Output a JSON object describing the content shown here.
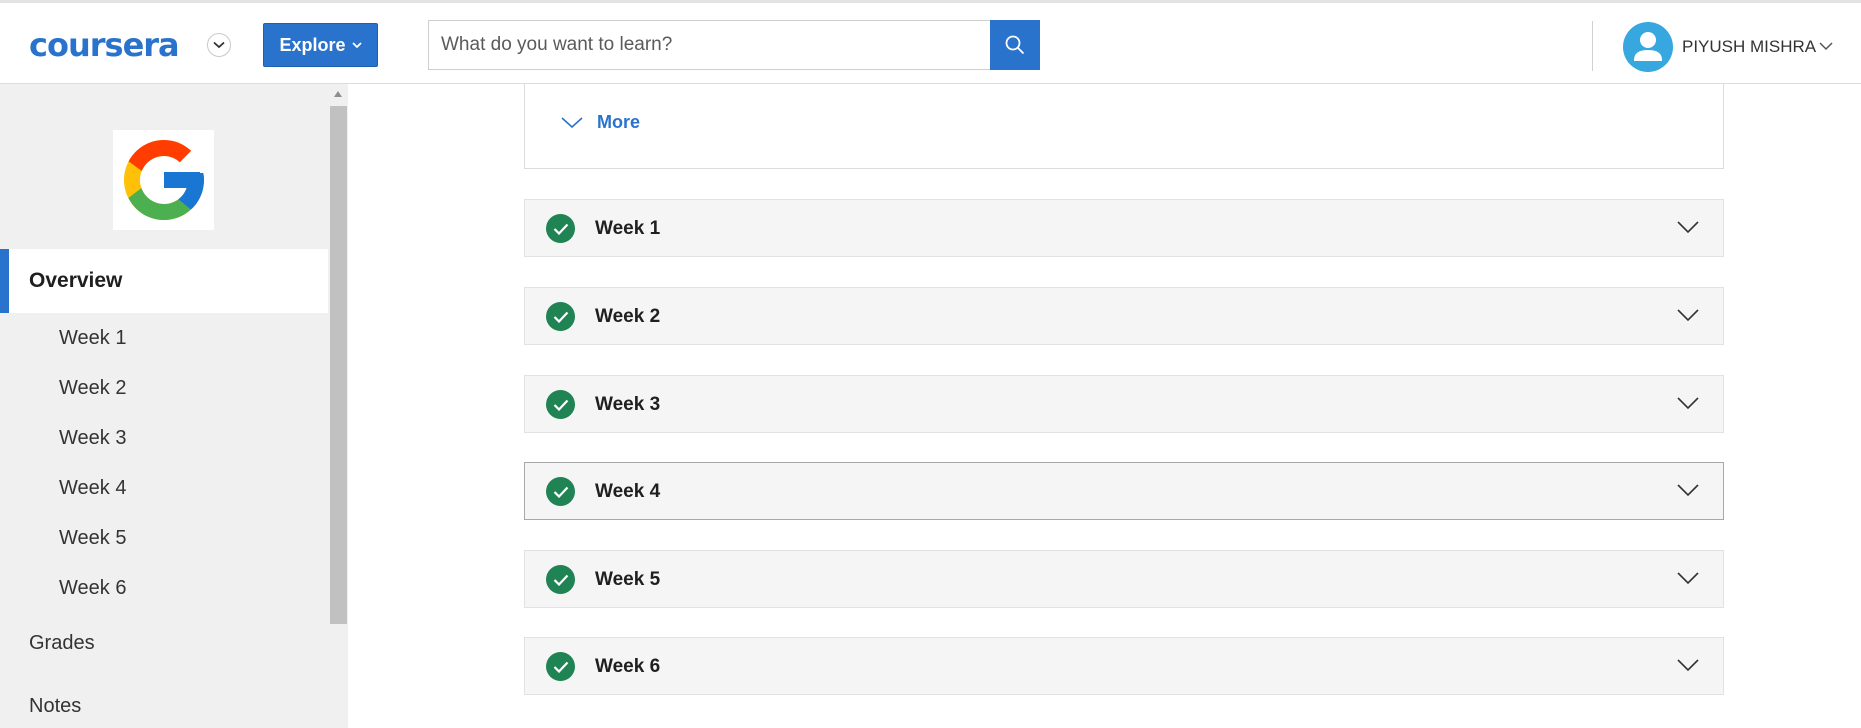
{
  "header": {
    "logo_text": "coursera",
    "explore_label": "Explore",
    "search": {
      "placeholder": "What do you want to learn?",
      "value": ""
    },
    "user_name": "PIYUSH MISHRA"
  },
  "sidebar": {
    "overview_label": "Overview",
    "weeks": [
      "Week 1",
      "Week 2",
      "Week 3",
      "Week 4",
      "Week 5",
      "Week 6"
    ],
    "grades_label": "Grades",
    "notes_label": "Notes"
  },
  "main": {
    "more_label": "More",
    "weeks": [
      {
        "label": "Week 1",
        "completed": true
      },
      {
        "label": "Week 2",
        "completed": true
      },
      {
        "label": "Week 3",
        "completed": true
      },
      {
        "label": "Week 4",
        "completed": true
      },
      {
        "label": "Week 5",
        "completed": true
      },
      {
        "label": "Week 6",
        "completed": true
      }
    ]
  },
  "icons": {
    "search": "search-icon",
    "user": "user-icon",
    "check": "check-icon",
    "chevron": "chevron-down-icon"
  },
  "colors": {
    "brand_blue": "#2a73cc",
    "check_green": "#1f8354",
    "avatar_blue": "#37a7e0",
    "sidebar_bg": "#f0f0f0"
  }
}
